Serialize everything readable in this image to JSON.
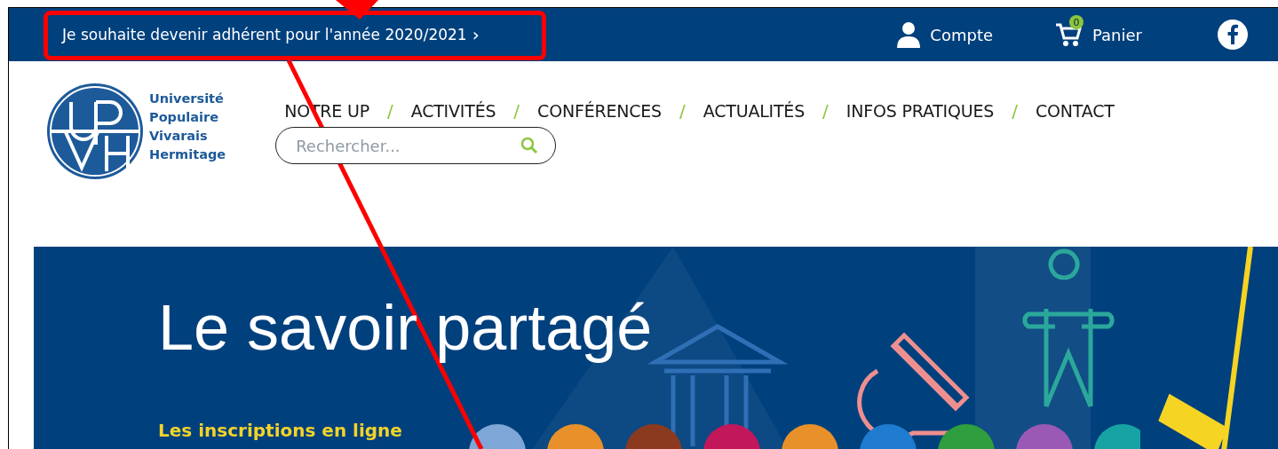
{
  "top_bar": {
    "membership_link": "Je souhaite devenir adhérent pour l'année 2020/2021",
    "membership_chevron": "›",
    "account": "Compte",
    "cart": {
      "count": "0",
      "label": "Panier"
    }
  },
  "header": {
    "logo_text": [
      "Université",
      "Populaire",
      "Vivarais",
      "Hermitage"
    ],
    "nav": [
      {
        "label": "NOTRE UP"
      },
      {
        "label": "ACTIVITÉS"
      },
      {
        "label": "CONFÉRENCES"
      },
      {
        "label": "ACTUALITÉS"
      },
      {
        "label": "INFOS PRATIQUES"
      },
      {
        "label": "CONTACT"
      }
    ],
    "nav_separator": "/",
    "search": {
      "placeholder": "Rechercher..."
    }
  },
  "hero": {
    "title": "Le savoir partagé",
    "subtitle": "Les inscriptions en ligne"
  }
}
